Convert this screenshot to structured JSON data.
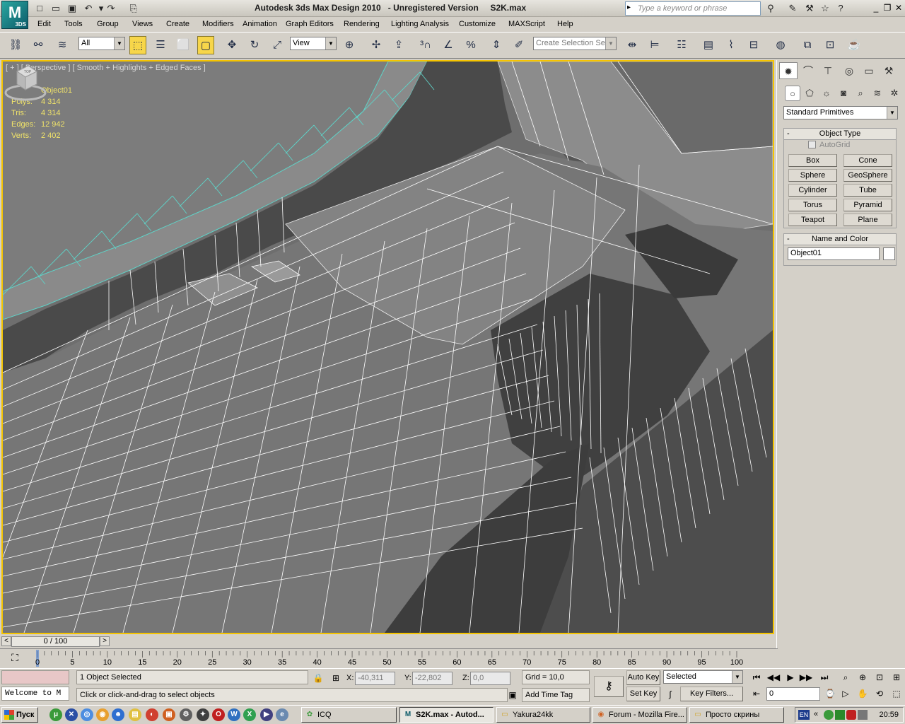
{
  "app": {
    "title": "Autodesk 3ds Max Design 2010   - Unregistered Version     S2K.max",
    "logo_text": "M",
    "logo_sub": "3DS",
    "search_placeholder": "Type a keyword or phrase"
  },
  "menu": [
    "Edit",
    "Tools",
    "Group",
    "Views",
    "Create",
    "Modifiers",
    "Animation",
    "Graph Editors",
    "Rendering",
    "Lighting Analysis",
    "Customize",
    "MAXScript",
    "Help"
  ],
  "toolbar": {
    "filter_value": "All",
    "refcoord_value": "View",
    "selection_set_placeholder": "Create Selection Se"
  },
  "viewport": {
    "label": "[ + ] [ Perspective ] [ Smooth + Highlights + Edged Faces ]",
    "stats": {
      "object": "Object01",
      "rows": [
        {
          "label": "Polys:",
          "value": "4 314"
        },
        {
          "label": "Tris:",
          "value": "4 314"
        },
        {
          "label": "Edges:",
          "value": "12 942"
        },
        {
          "label": "Verts:",
          "value": "2 402"
        }
      ]
    },
    "viewcube_label": "TOP",
    "colors": {
      "yellow_border": "#f5c400",
      "stats_text": "#f0e36a",
      "wire": "#ffffff",
      "selected_wire": "#5fd3c8"
    }
  },
  "command_panel": {
    "category": "Standard Primitives",
    "object_type_title": "Object Type",
    "autogrid_label": "AutoGrid",
    "buttons": [
      "Box",
      "Cone",
      "Sphere",
      "GeoSphere",
      "Cylinder",
      "Tube",
      "Torus",
      "Pyramid",
      "Teapot",
      "Plane"
    ],
    "name_color_title": "Name and Color",
    "name_value": "Object01"
  },
  "timeslider": {
    "frame_display": "0 / 100",
    "left_arrow": "<",
    "right_arrow": ">",
    "ticks": [
      "0",
      "5",
      "10",
      "15",
      "20",
      "25",
      "30",
      "35",
      "40",
      "45",
      "50",
      "55",
      "60",
      "65",
      "70",
      "75",
      "80",
      "85",
      "90",
      "95",
      "100"
    ]
  },
  "status": {
    "maxscript_listener": "Welcome to M",
    "selection": "1 Object Selected",
    "prompt": "Click or click-and-drag to select objects",
    "x_label": "X:",
    "x_value": "-40,311",
    "y_label": "Y:",
    "y_value": "-22,802",
    "z_label": "Z:",
    "z_value": "0,0",
    "grid": "Grid = 10,0",
    "add_time_tag": "Add Time Tag",
    "auto_key": "Auto Key",
    "set_key": "Set Key",
    "key_mode": "Selected",
    "key_filters": "Key Filters...",
    "current_frame": "0"
  },
  "taskbar": {
    "start": "Пуск",
    "tasks": [
      {
        "label": "ICQ",
        "active": false
      },
      {
        "label": "S2K.max - Autod...",
        "active": true
      },
      {
        "label": "Yakura24kk",
        "active": false
      },
      {
        "label": "Forum - Mozilla Fire...",
        "active": false
      },
      {
        "label": "Просто скрины",
        "active": false
      }
    ],
    "lang": "EN",
    "clock": "20:59"
  }
}
